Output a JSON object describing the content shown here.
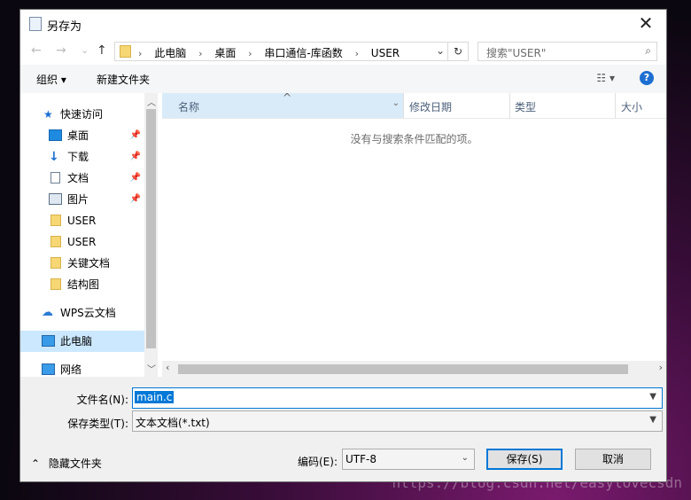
{
  "window": {
    "title": "另存为",
    "close": "✕"
  },
  "nav": {
    "back": "←",
    "forward": "→",
    "recent": "⌄",
    "up": "↑",
    "breadcrumbs": [
      "此电脑",
      "桌面",
      "串口通信-库函数",
      "USER"
    ],
    "separator": "›",
    "dropdown": "⌄",
    "refresh": "↻",
    "search_placeholder": "搜索\"USER\"",
    "search_icon": "⌕"
  },
  "toolbar": {
    "organize": "组织 ▾",
    "new_folder": "新建文件夹",
    "view": "☷ ▾",
    "help": "?"
  },
  "sidebar": {
    "items": [
      {
        "label": "快速访问",
        "icon": "star-icon",
        "pinned": false
      },
      {
        "label": "桌面",
        "icon": "desktop-icon",
        "pinned": true
      },
      {
        "label": "下载",
        "icon": "download-icon",
        "pinned": true
      },
      {
        "label": "文档",
        "icon": "document-icon",
        "pinned": true
      },
      {
        "label": "图片",
        "icon": "picture-icon",
        "pinned": true
      },
      {
        "label": "USER",
        "icon": "folder-icon",
        "pinned": false
      },
      {
        "label": "USER",
        "icon": "folder-icon",
        "pinned": false
      },
      {
        "label": "关键文档",
        "icon": "folder-icon",
        "pinned": false
      },
      {
        "label": "结构图",
        "icon": "folder-icon",
        "pinned": false
      },
      {
        "label": "WPS云文档",
        "icon": "cloud-icon",
        "pinned": false
      },
      {
        "label": "此电脑",
        "icon": "computer-icon",
        "pinned": false,
        "selected": true
      },
      {
        "label": "网络",
        "icon": "network-icon",
        "pinned": false
      }
    ],
    "pin_glyph": "📌"
  },
  "columns": {
    "name": "名称",
    "sort": "^",
    "modified": "修改日期",
    "type": "类型",
    "size": "大小"
  },
  "empty_message": "没有与搜索条件匹配的项。",
  "form": {
    "filename_label": "文件名(N):",
    "filename_value": "main.c",
    "filetype_label": "保存类型(T):",
    "filetype_value": "文本文档(*.txt)",
    "hide_folders": "隐藏文件夹",
    "encoding_label": "编码(E):",
    "encoding_value": "UTF-8",
    "save": "保存(S)",
    "cancel": "取消"
  },
  "watermark": "https://blog.csdn.net/easylovecsdn"
}
